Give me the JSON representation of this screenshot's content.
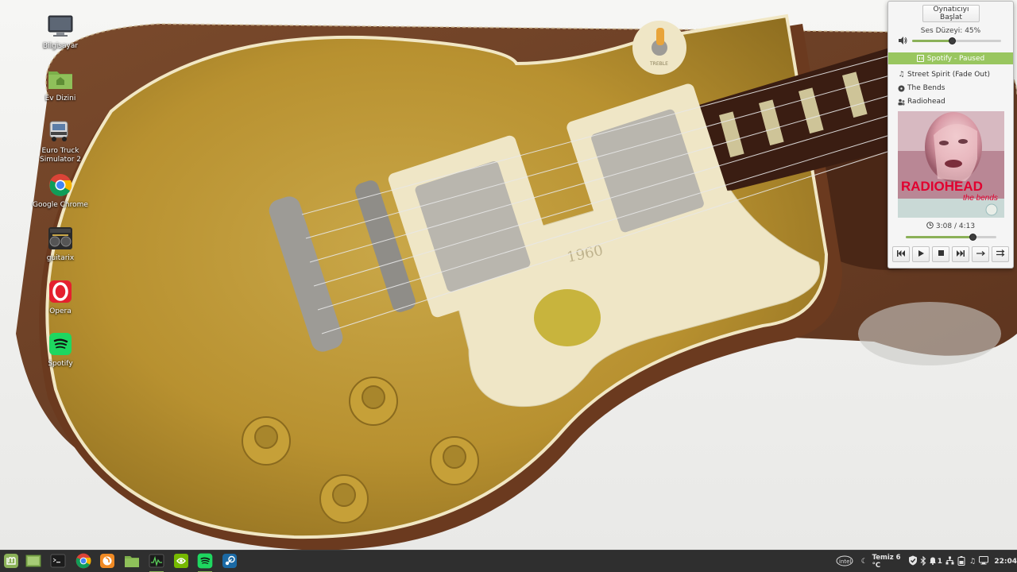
{
  "desktop": {
    "icons": [
      {
        "label": "Bilgisayar",
        "icon": "computer-icon"
      },
      {
        "label": "Ev Dizini",
        "icon": "home-folder-icon"
      },
      {
        "label": "Euro Truck Simulator 2",
        "icon": "truck-game-icon"
      },
      {
        "label": "Google Chrome",
        "icon": "chrome-icon"
      },
      {
        "label": "guitarix",
        "icon": "guitarix-icon"
      },
      {
        "label": "Opera",
        "icon": "opera-icon"
      },
      {
        "label": "Spotify",
        "icon": "spotify-icon"
      }
    ],
    "wallpaper": {
      "engraving": "1960",
      "pickup_selector_label": "TREBLE"
    }
  },
  "sound_applet": {
    "start_player_label": "Oynatıcıyı Başlat",
    "volume_label": "Ses Düzeyi: 45%",
    "volume_value": 45,
    "player_status": "Spotify - Paused",
    "track_title": "Street Spirit (Fade Out)",
    "album": "The Bends",
    "artist": "Radiohead",
    "album_art_text": {
      "band": "RADIOHEAD",
      "album": "the bends"
    },
    "time_label": "3:08 / 4:13",
    "position_fraction": 0.74,
    "controls": [
      "previous-icon",
      "play-icon",
      "stop-icon",
      "next-icon",
      "repeat-icon",
      "shuffle-icon"
    ]
  },
  "panel": {
    "launchers": [
      "mint-menu-icon",
      "show-desktop-icon",
      "terminal-icon",
      "chrome-icon",
      "firefox-icon",
      "files-icon",
      "system-monitor-icon",
      "nvidia-icon",
      "spotify-icon",
      "steam-icon"
    ],
    "tray": {
      "weather_label": "Temiz 6 °C",
      "notifications_count": "1",
      "clock": "22:04"
    }
  },
  "colors": {
    "accent": "#8bb158",
    "panel": "#2f2f2f",
    "popup_bg": "#f5f5f5"
  }
}
